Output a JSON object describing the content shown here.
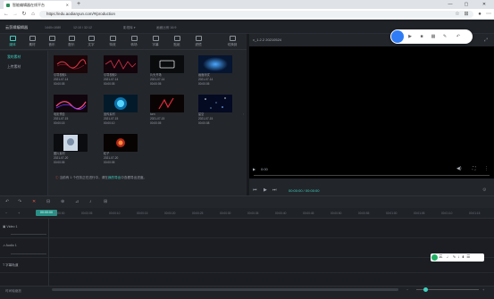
{
  "browser": {
    "tab_title": "智能编辑器在线平台",
    "url": "https://edu.aodianyun.com/#/production",
    "win_controls": [
      "—",
      "▢",
      "✕"
    ]
  },
  "app": {
    "title": "云剪辑编辑器",
    "stats": [
      "1440×1080",
      "12:10 / 32:12",
      "影视库 ▾",
      "画面比例 16:9"
    ],
    "left_tabs": [
      "媒体",
      "素材",
      "音乐",
      "配乐",
      "文字",
      "特效",
      "转场",
      "字幕",
      "贴纸",
      "滤镜"
    ],
    "right_tab": "切换到",
    "sidebar": [
      "我的素材",
      "上传素材"
    ],
    "media": [
      {
        "name": "引导视频1",
        "date": "2021-07-14",
        "dur": "00:00:05"
      },
      {
        "name": "引导视频2",
        "date": "2021-07-14",
        "dur": "00:00:05"
      },
      {
        "name": "片头开场",
        "date": "2021-07-14",
        "dur": "00:00:05"
      },
      {
        "name": "画面测试",
        "date": "2021-07-14",
        "dur": "00:00:05"
      },
      {
        "name": "电影预告",
        "date": "2021-07-15",
        "dur": "00:00:15"
      },
      {
        "name": "宣传素材",
        "date": "2021-07-15",
        "dur": "00:00:10"
      },
      {
        "name": "turn",
        "date": "2021-07-15",
        "dur": "00:00:05"
      },
      {
        "name": "星空",
        "date": "2021-07-15",
        "dur": "00:00:08"
      },
      {
        "name": "图片素材",
        "date": "2021-07-20",
        "dur": "00:00:05"
      },
      {
        "name": "粒子",
        "date": "2021-07-20",
        "dur": "00:00:05"
      }
    ],
    "notice_pre": "当前有 1 个任务正在进行中，请在",
    "notice_hl": "我的导出",
    "notice_post": "中查看导出进度。",
    "preview_label": "v_1.2.2 20210524",
    "preview_time": "00:00:00 / 00:00:00",
    "video_time": "0:00",
    "timeline_marks": [
      "00:00:00",
      "00:00:05",
      "00:00:10",
      "00:00:15",
      "00:00:20",
      "00:00:25",
      "00:00:30",
      "00:00:35",
      "00:00:40",
      "00:00:45",
      "00:00:50",
      "00:00:55",
      "00:01:00",
      "00:01:05",
      "00:01:10",
      "00:01:15"
    ],
    "time_badge": "00:00:00",
    "tracks": [
      "Video 1",
      "Audio 1",
      "字幕轨道"
    ],
    "bottom_label": "时间轴缩放",
    "float_tip": "三"
  },
  "colors": {
    "accent": "#3fd1c1",
    "bg": "#1b1d22",
    "browser_blue": "#2f7cf6"
  }
}
